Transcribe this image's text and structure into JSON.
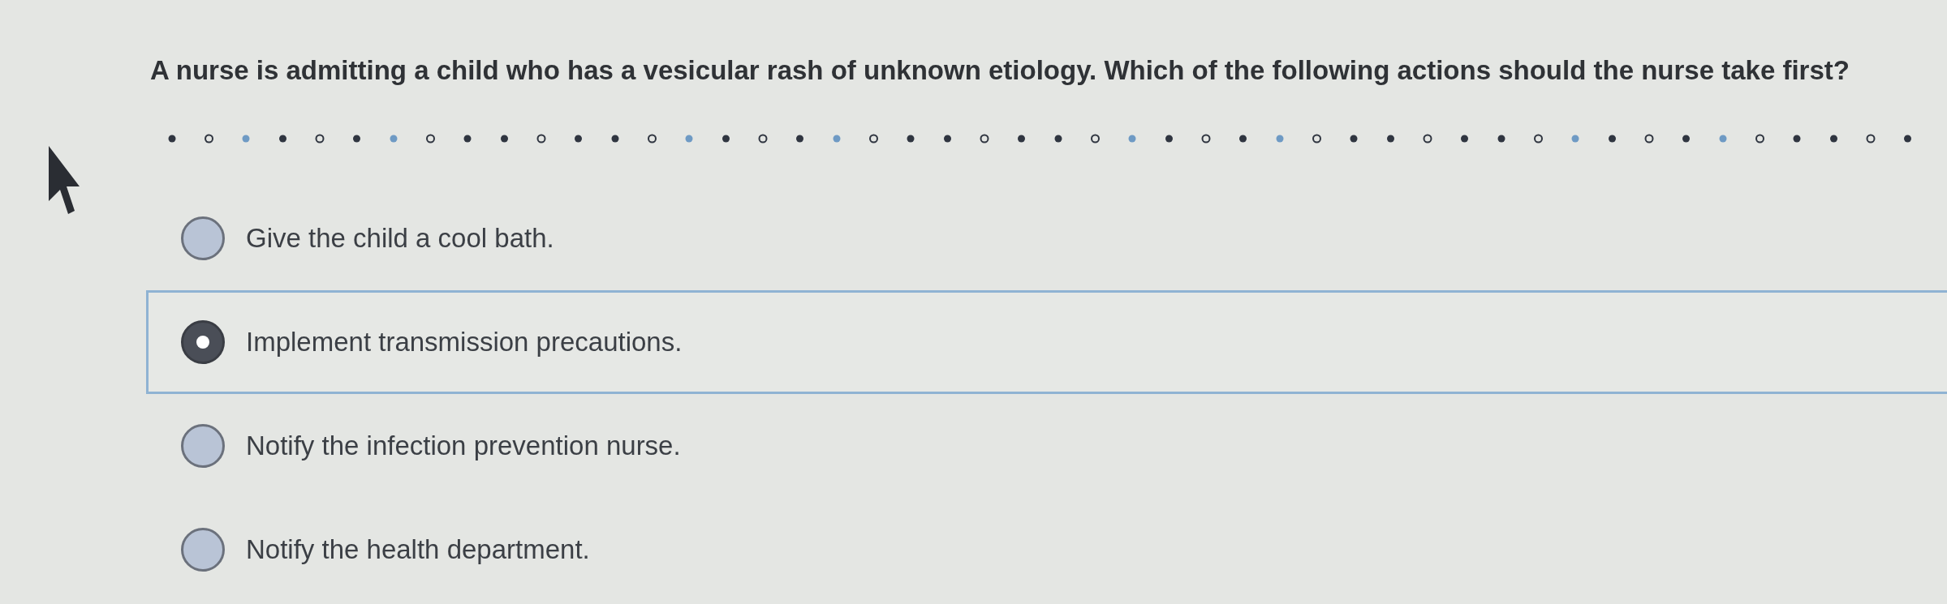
{
  "question": "A nurse is admitting a child who has a vesicular rash of unknown etiology. Which of the following actions should the nurse take first?",
  "options": [
    {
      "label": "Give the child a cool bath.",
      "selected": false
    },
    {
      "label": "Implement transmission precautions.",
      "selected": true
    },
    {
      "label": "Notify the infection prevention nurse.",
      "selected": false
    },
    {
      "label": "Notify the health department.",
      "selected": false
    }
  ]
}
